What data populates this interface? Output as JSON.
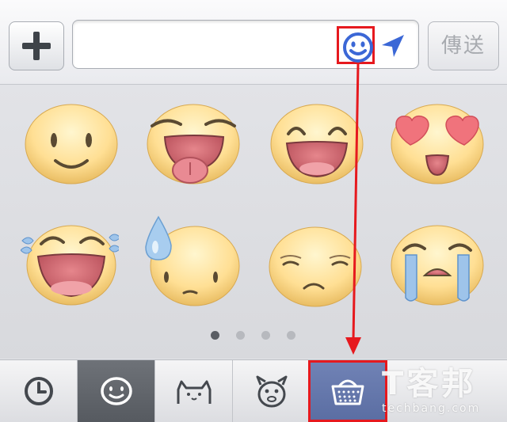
{
  "composer": {
    "send_label": "傳送",
    "input_value": ""
  },
  "icons": {
    "add": "plus-icon",
    "emoji": "smiley-face-icon",
    "location": "location-arrow-icon",
    "recent_tab": "clock-icon",
    "emoji_tab": "smiley-face-icon",
    "cat_tab": "cat-icon",
    "monster_tab": "monster-icon",
    "shop_tab": "basket-icon"
  },
  "stickers": [
    "smile-sticker",
    "tongue-out-sticker",
    "grin-sticker",
    "heart-eyes-sticker",
    "laughing-tears-sticker",
    "sweat-drop-sticker",
    "worried-sticker",
    "crying-sticker"
  ],
  "pager": {
    "page_count": 4,
    "current_page": 1
  },
  "watermark": {
    "line1": "T客邦",
    "line2": "techbang.com"
  },
  "colors": {
    "highlight": "#e6191e",
    "accent_blue": "#3b67d6",
    "selected_tab": "#5e6268",
    "shop_tab": "#6577ac"
  }
}
